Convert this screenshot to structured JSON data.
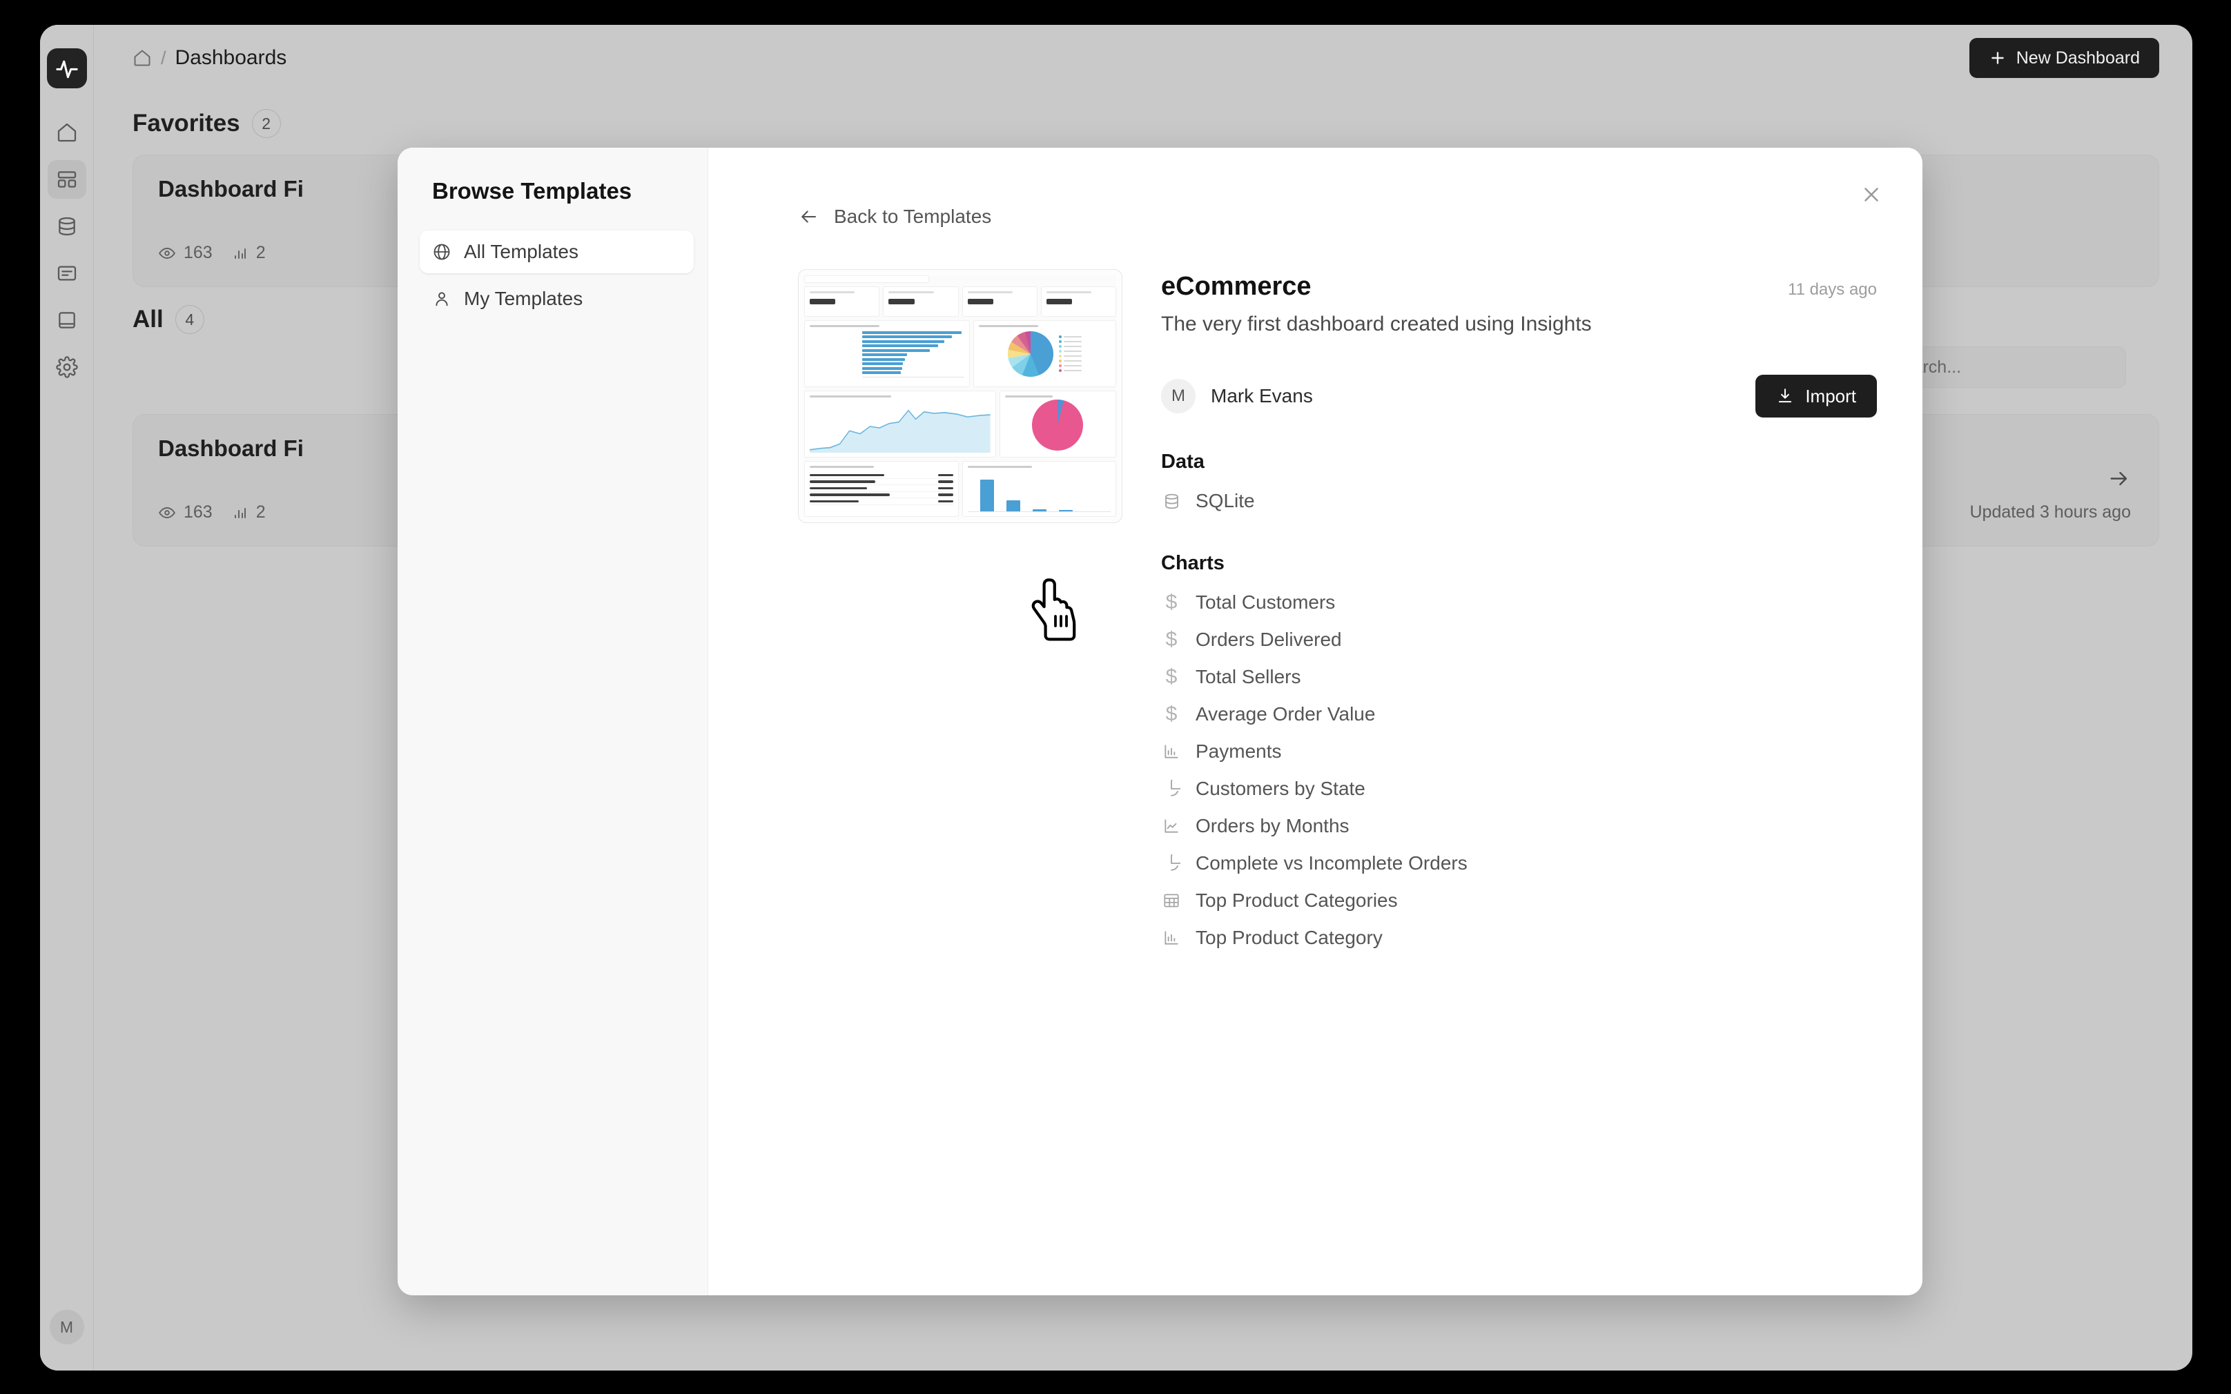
{
  "app": {
    "logo_icon": "activity-pulse-icon",
    "rail_items": [
      {
        "name": "home",
        "icon": "home-icon",
        "active": false
      },
      {
        "name": "dashboards",
        "icon": "dashboard-grid-icon",
        "active": true
      },
      {
        "name": "data",
        "icon": "database-icon",
        "active": false
      },
      {
        "name": "queries",
        "icon": "document-lines-icon",
        "active": false
      },
      {
        "name": "docs",
        "icon": "book-icon",
        "active": false
      },
      {
        "name": "settings",
        "icon": "gear-icon",
        "active": false
      }
    ],
    "user_initial": "M"
  },
  "topbar": {
    "home_icon": "home-icon",
    "separator": "/",
    "title": "Dashboards",
    "new_dashboard_label": "New Dashboard",
    "plus_icon": "plus-icon"
  },
  "page": {
    "sections": [
      {
        "title": "Favorites",
        "count": "2",
        "cards": [
          {
            "title": "Dashboard Fi",
            "views_icon": "eye-icon",
            "views": "163",
            "charts_icon": "bar-chart-icon",
            "charts": "2",
            "updated": "",
            "arrow_icon": ""
          }
        ]
      },
      {
        "title": "All",
        "count": "4",
        "cards": [
          {
            "title": "Dashboard Fi",
            "views_icon": "eye-icon",
            "views": "163",
            "charts_icon": "bar-chart-icon",
            "charts": "2",
            "updated": "Updated 3 hours ago",
            "arrow_icon": "arrow-right-icon"
          }
        ]
      }
    ],
    "search": {
      "placeholder": "Search...",
      "icon": "search-icon",
      "value": ""
    }
  },
  "modal": {
    "sidebar": {
      "title": "Browse Templates",
      "items": [
        {
          "label": "All Templates",
          "icon": "globe-icon",
          "active": true
        },
        {
          "label": "My Templates",
          "icon": "person-icon",
          "active": false
        }
      ]
    },
    "close_icon": "close-icon",
    "back_link": {
      "label": "Back to Templates",
      "icon": "arrow-left-icon"
    },
    "template": {
      "name": "eCommerce",
      "age": "11 days ago",
      "description": "The very first dashboard created using Insights",
      "author": {
        "initial": "M",
        "name": "Mark Evans"
      },
      "import_label": "Import",
      "import_icon": "download-icon",
      "data_heading": "Data",
      "data_sources": [
        {
          "label": "SQLite",
          "icon": "database-icon"
        }
      ],
      "charts_heading": "Charts",
      "charts": [
        {
          "label": "Total Customers",
          "icon": "dollar-icon"
        },
        {
          "label": "Orders Delivered",
          "icon": "dollar-icon"
        },
        {
          "label": "Total Sellers",
          "icon": "dollar-icon"
        },
        {
          "label": "Average Order Value",
          "icon": "dollar-icon"
        },
        {
          "label": "Payments",
          "icon": "bar-chart-icon"
        },
        {
          "label": "Customers by State",
          "icon": "pie-chart-icon"
        },
        {
          "label": "Orders by Months",
          "icon": "line-chart-icon"
        },
        {
          "label": "Complete vs Incomplete Orders",
          "icon": "pie-chart-icon"
        },
        {
          "label": "Top Product Categories",
          "icon": "table-icon"
        },
        {
          "label": "Top Product Category",
          "icon": "bar-chart-icon"
        }
      ],
      "preview_alt": "dashboard-preview-thumbnail"
    }
  },
  "cursor": {
    "type": "pointing-hand-cursor"
  },
  "colors": {
    "accent": "#1e1e1e",
    "bg": "#c9c9c9",
    "modal_bg": "#ffffff",
    "chart_blue": "#4a9fd4",
    "chart_pink": "#e8578f"
  }
}
